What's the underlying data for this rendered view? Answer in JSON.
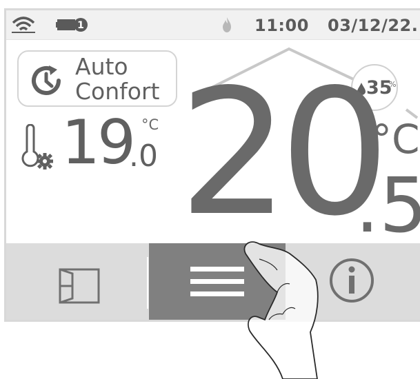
{
  "status_bar": {
    "wifi_icon": "wifi-icon",
    "battery_icon": "battery-icon",
    "battery_badge": "1",
    "flame_icon": "flame-icon",
    "time": "11:00",
    "date": "03/12/22."
  },
  "mode": {
    "icon": "clock-refresh-icon",
    "line1": "Auto",
    "line2": "Confort"
  },
  "humidity": {
    "value": "35",
    "unit": "%",
    "icon": "drop-icon"
  },
  "setpoint": {
    "icon": "thermometer-gear-icon",
    "integer": "19",
    "decimal": ".0",
    "unit": "°C"
  },
  "temperature": {
    "integer": "20",
    "decimal": ".5",
    "unit": "°C"
  },
  "nav": [
    {
      "id": "window",
      "icon": "window-icon"
    },
    {
      "id": "menu",
      "icon": "menu-icon",
      "active": true
    },
    {
      "id": "info",
      "icon": "info-icon"
    }
  ],
  "colors": {
    "text": "#606060",
    "nav_background": "#dcdcdc",
    "nav_active": "#808080",
    "status_bar": "#f1f1f1"
  }
}
